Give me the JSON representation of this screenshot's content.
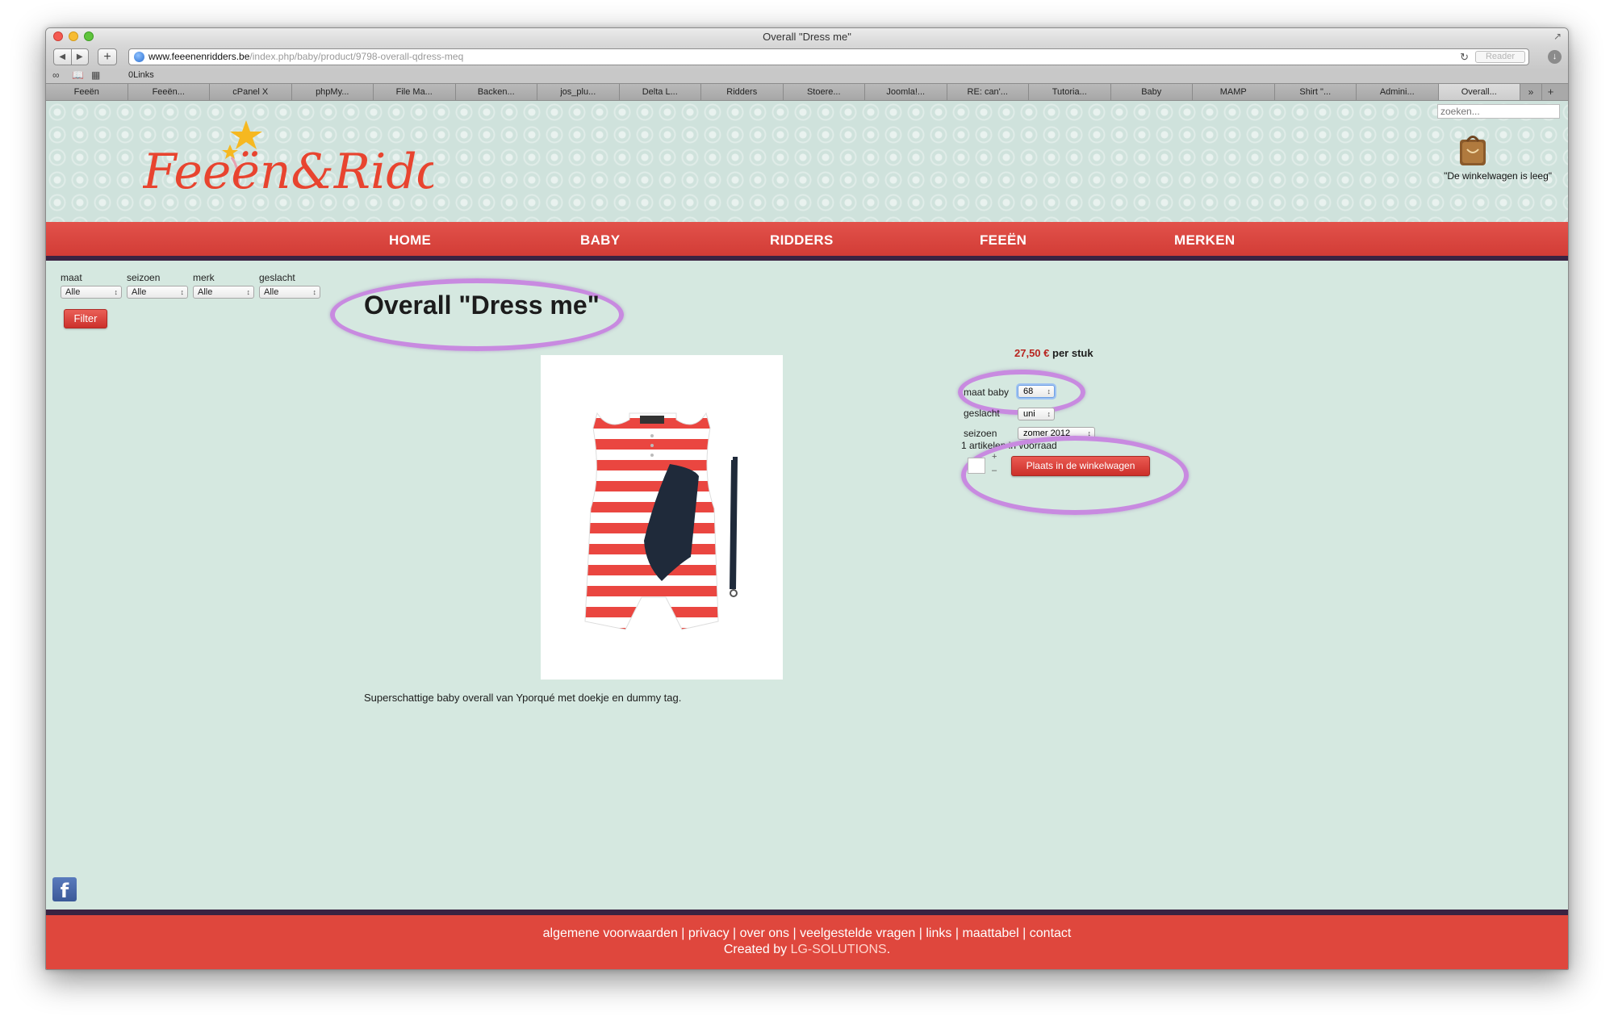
{
  "window": {
    "title": "Overall \"Dress me\""
  },
  "toolbar": {
    "url_host": "www.feeenenridders.be",
    "url_path": "/index.php/baby/product/9798-overall-qdress-meq",
    "reader_label": "Reader",
    "add_tab_label": "+"
  },
  "bookmarks": {
    "links_label": "0Links"
  },
  "tabs": [
    "Feeën",
    "Feeën...",
    "cPanel X",
    "phpMy...",
    "File Ma...",
    "Backen...",
    "jos_plu...",
    "Delta L...",
    "Ridders",
    "Stoere...",
    "Joomla!...",
    "RE: can'...",
    "Tutoria...",
    "Baby",
    "MAMP",
    "Shirt \"...",
    "Admini...",
    "Overall..."
  ],
  "header": {
    "search_placeholder": "zoeken...",
    "cart_status": "\"De winkelwagen is leeg\"",
    "logo_text": "Feeën&Ridders"
  },
  "menu": [
    "HOME",
    "BABY",
    "RIDDERS",
    "FEEËN",
    "MERKEN"
  ],
  "filters": {
    "groups": [
      {
        "label": "maat",
        "value": "Alle"
      },
      {
        "label": "seizoen",
        "value": "Alle"
      },
      {
        "label": "merk",
        "value": "Alle"
      },
      {
        "label": "geslacht",
        "value": "Alle"
      }
    ],
    "button_label": "Filter"
  },
  "product": {
    "title": "Overall \"Dress me\"",
    "description": "Superschattige baby overall van Yporqué met doekje en dummy tag.",
    "price_value": "27,50 €",
    "price_unit": "per stuk",
    "options": [
      {
        "label": "maat baby",
        "value": "68"
      },
      {
        "label": "geslacht",
        "value": "uni"
      },
      {
        "label": "seizoen",
        "value": "zomer 2012"
      }
    ],
    "stock_text": "1 artikelen in voorraad",
    "qty_plus": "+",
    "qty_minus": "–",
    "add_to_cart_label": "Plaats in de winkelwagen"
  },
  "footer": {
    "links": [
      "algemene voorwaarden",
      "privacy",
      "over ons",
      "veelgestelde vragen",
      "links",
      "maattabel",
      "contact"
    ],
    "separator": "|",
    "credit_prefix": "Created by",
    "credit_brand": "LG-SOLUTIONS",
    "credit_suffix": "."
  },
  "colors": {
    "accent_red": "#d23c36",
    "page_bg": "#d5e8e0",
    "annotation_purple": "#c88ae0",
    "menu_border": "#3a2342"
  }
}
